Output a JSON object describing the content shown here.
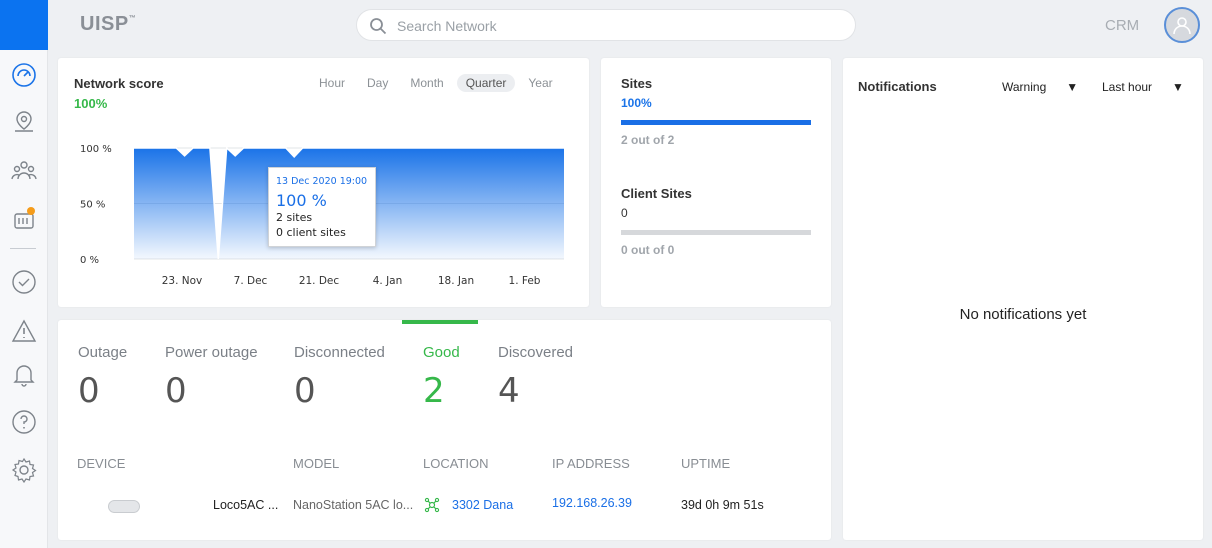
{
  "header": {
    "logo": "UISP",
    "logo_mark": "™",
    "search_placeholder": "Search Network",
    "crm": "CRM"
  },
  "rail": {
    "icons": [
      "dashboard-icon",
      "map-pin-icon",
      "clients-icon",
      "devices-icon",
      "tasks-icon",
      "alert-icon",
      "bell-icon",
      "help-icon",
      "settings-icon"
    ],
    "colors": {
      "active": "#0b73f0",
      "badge": "#f59c1a"
    }
  },
  "network_score": {
    "title": "Network score",
    "value": "100%",
    "ranges": [
      "Hour",
      "Day",
      "Month",
      "Quarter",
      "Year"
    ],
    "active_range": "Quarter"
  },
  "chart_data": {
    "type": "area",
    "title": "",
    "y_ticks": [
      "100 %",
      "50 %",
      "0 %"
    ],
    "x_ticks": [
      "23. Nov",
      "7. Dec",
      "21. Dec",
      "4. Jan",
      "18. Jan",
      "1. Feb"
    ],
    "ylim": [
      0,
      100
    ],
    "series": [
      {
        "values": [
          100,
          100,
          100,
          100,
          100,
          100,
          93,
          100,
          100,
          100,
          0,
          100,
          93,
          100,
          100,
          100,
          100,
          100,
          100,
          92,
          100,
          100,
          100,
          100,
          100,
          100,
          100,
          100,
          100,
          100,
          100,
          100,
          100,
          100,
          100,
          100,
          100,
          100,
          100,
          100,
          100,
          100,
          100,
          100,
          100,
          100,
          100,
          100,
          100,
          100,
          100,
          100
        ]
      }
    ],
    "color": "#1a73e8",
    "tooltip": {
      "date": "13 Dec 2020 19:00",
      "value": "100 %",
      "sites": "2 sites",
      "client_sites": "0 client sites"
    }
  },
  "sites": {
    "title": "Sites",
    "pct": "100%",
    "fill_fraction": 1.0,
    "count": "2  out of 2",
    "client_title": "Client Sites",
    "client_value": "0",
    "client_fill_fraction": 0.0,
    "client_count": "0  out of 0"
  },
  "notifications": {
    "title": "Notifications",
    "level": "Warning",
    "period": "Last hour",
    "empty": "No notifications yet"
  },
  "status": {
    "items": [
      {
        "label": "Outage",
        "value": "0"
      },
      {
        "label": "Power outage",
        "value": "0"
      },
      {
        "label": "Disconnected",
        "value": "0"
      },
      {
        "label": "Good",
        "value": "2"
      },
      {
        "label": "Discovered",
        "value": "4"
      }
    ],
    "active": "Good"
  },
  "table": {
    "headers": [
      "DEVICE",
      "MODEL",
      "LOCATION",
      "IP ADDRESS",
      "UPTIME"
    ],
    "rows": [
      {
        "device": "Loco5AC ...",
        "model": "NanoStation 5AC lo...",
        "location": "3302 Dana",
        "ip": "192.168.26.39",
        "uptime": "39d 0h 9m 51s"
      }
    ]
  }
}
